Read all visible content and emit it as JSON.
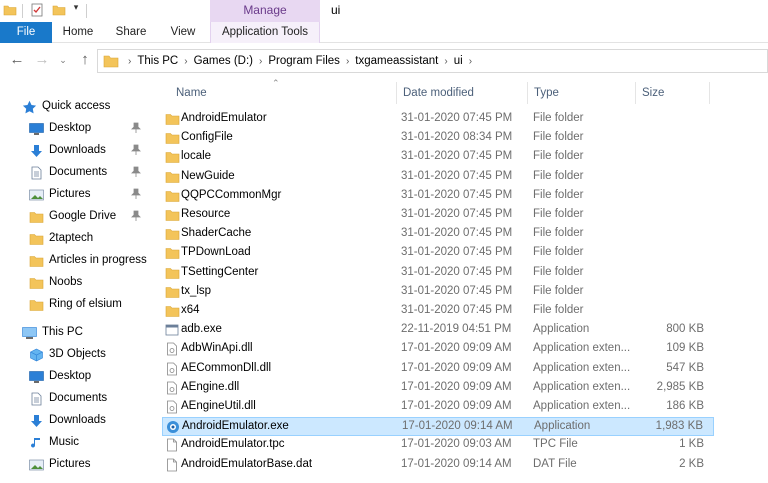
{
  "window": {
    "title": "ui"
  },
  "quick_access_toolbar": {
    "icons": [
      "folder-icon",
      "properties-icon",
      "new-folder-icon",
      "customize-dropdown-icon"
    ]
  },
  "ribbon": {
    "context_header": "Manage",
    "tabs": [
      "File",
      "Home",
      "Share",
      "View",
      "Application Tools"
    ]
  },
  "address_bar": {
    "segments": [
      "This PC",
      "Games (D:)",
      "Program Files",
      "txgameassistant",
      "ui"
    ]
  },
  "nav_pane": {
    "quick_access_label": "Quick access",
    "quick_access_items": [
      {
        "label": "Desktop",
        "icon": "desktop-icon",
        "pinned": true
      },
      {
        "label": "Downloads",
        "icon": "downloads-icon",
        "pinned": true
      },
      {
        "label": "Documents",
        "icon": "documents-icon",
        "pinned": true
      },
      {
        "label": "Pictures",
        "icon": "pictures-icon",
        "pinned": true
      },
      {
        "label": "Google Drive",
        "icon": "folder-icon",
        "pinned": true
      },
      {
        "label": "2taptech",
        "icon": "folder-icon",
        "pinned": false
      },
      {
        "label": "Articles in progress",
        "icon": "folder-icon",
        "pinned": false
      },
      {
        "label": "Noobs",
        "icon": "folder-icon",
        "pinned": false
      },
      {
        "label": "Ring of elsium",
        "icon": "folder-icon",
        "pinned": false
      }
    ],
    "this_pc_label": "This PC",
    "this_pc_items": [
      {
        "label": "3D Objects",
        "icon": "3d-objects-icon"
      },
      {
        "label": "Desktop",
        "icon": "desktop-icon"
      },
      {
        "label": "Documents",
        "icon": "documents-icon"
      },
      {
        "label": "Downloads",
        "icon": "downloads-icon"
      },
      {
        "label": "Music",
        "icon": "music-icon"
      },
      {
        "label": "Pictures",
        "icon": "pictures-icon"
      }
    ]
  },
  "file_list": {
    "columns": {
      "name": "Name",
      "date": "Date modified",
      "type": "Type",
      "size": "Size"
    },
    "rows": [
      {
        "name": "AndroidEmulator",
        "date": "31-01-2020 07:45 PM",
        "type": "File folder",
        "size": "",
        "icon": "folder-icon"
      },
      {
        "name": "ConfigFile",
        "date": "31-01-2020 08:34 PM",
        "type": "File folder",
        "size": "",
        "icon": "folder-icon"
      },
      {
        "name": "locale",
        "date": "31-01-2020 07:45 PM",
        "type": "File folder",
        "size": "",
        "icon": "folder-icon"
      },
      {
        "name": "NewGuide",
        "date": "31-01-2020 07:45 PM",
        "type": "File folder",
        "size": "",
        "icon": "folder-icon"
      },
      {
        "name": "QQPCCommonMgr",
        "date": "31-01-2020 07:45 PM",
        "type": "File folder",
        "size": "",
        "icon": "folder-icon"
      },
      {
        "name": "Resource",
        "date": "31-01-2020 07:45 PM",
        "type": "File folder",
        "size": "",
        "icon": "folder-icon"
      },
      {
        "name": "ShaderCache",
        "date": "31-01-2020 07:45 PM",
        "type": "File folder",
        "size": "",
        "icon": "folder-icon"
      },
      {
        "name": "TPDownLoad",
        "date": "31-01-2020 07:45 PM",
        "type": "File folder",
        "size": "",
        "icon": "folder-icon"
      },
      {
        "name": "TSettingCenter",
        "date": "31-01-2020 07:45 PM",
        "type": "File folder",
        "size": "",
        "icon": "folder-icon"
      },
      {
        "name": "tx_lsp",
        "date": "31-01-2020 07:45 PM",
        "type": "File folder",
        "size": "",
        "icon": "folder-icon"
      },
      {
        "name": "x64",
        "date": "31-01-2020 07:45 PM",
        "type": "File folder",
        "size": "",
        "icon": "folder-icon"
      },
      {
        "name": "adb.exe",
        "date": "22-11-2019 04:51 PM",
        "type": "Application",
        "size": "800 KB",
        "icon": "application-icon"
      },
      {
        "name": "AdbWinApi.dll",
        "date": "17-01-2020 09:09 AM",
        "type": "Application exten...",
        "size": "109 KB",
        "icon": "dll-file-icon"
      },
      {
        "name": "AECommonDll.dll",
        "date": "17-01-2020 09:09 AM",
        "type": "Application exten...",
        "size": "547 KB",
        "icon": "dll-file-icon"
      },
      {
        "name": "AEngine.dll",
        "date": "17-01-2020 09:09 AM",
        "type": "Application exten...",
        "size": "2,985 KB",
        "icon": "dll-file-icon"
      },
      {
        "name": "AEngineUtil.dll",
        "date": "17-01-2020 09:09 AM",
        "type": "Application exten...",
        "size": "186 KB",
        "icon": "dll-file-icon"
      },
      {
        "name": "AndroidEmulator.exe",
        "date": "17-01-2020 09:14 AM",
        "type": "Application",
        "size": "1,983 KB",
        "icon": "emulator-app-icon",
        "selected": true
      },
      {
        "name": "AndroidEmulator.tpc",
        "date": "17-01-2020 09:03 AM",
        "type": "TPC File",
        "size": "1 KB",
        "icon": "blank-file-icon"
      },
      {
        "name": "AndroidEmulatorBase.dat",
        "date": "17-01-2020 09:14 AM",
        "type": "DAT File",
        "size": "2 KB",
        "icon": "blank-file-icon"
      }
    ]
  },
  "colors": {
    "file_tab": "#1979ca",
    "manage_header": "#e8d8f2",
    "selection": "#cce8ff",
    "folder": "#f3c45a"
  }
}
